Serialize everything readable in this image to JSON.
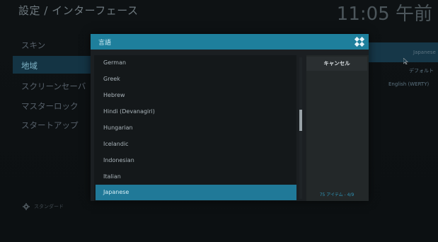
{
  "header": {
    "title": "設定 / インターフェース",
    "clock": "11:05 午前"
  },
  "left_menu": {
    "items": [
      {
        "label": "スキン"
      },
      {
        "label": "地域"
      },
      {
        "label": "スクリーンセーバ"
      },
      {
        "label": "マスターロック"
      },
      {
        "label": "スタートアップ"
      }
    ],
    "active_index": 1,
    "footer_label": "スタンダード"
  },
  "background_right": {
    "values": [
      "Japanese",
      "デフォルト",
      "English (WERTY)"
    ]
  },
  "dialog": {
    "title": "言語",
    "languages": [
      "German",
      "Greek",
      "Hebrew",
      "Hindi (Devanagiri)",
      "Hungarian",
      "Icelandic",
      "Indonesian",
      "Italian",
      "Japanese"
    ],
    "selected": "Japanese",
    "cancel_label": "キャンセル",
    "item_count": "75 アイテム - 4/9"
  },
  "colors": {
    "accent": "#1e7f9c",
    "selected": "#207998",
    "background": "#0e1214"
  }
}
